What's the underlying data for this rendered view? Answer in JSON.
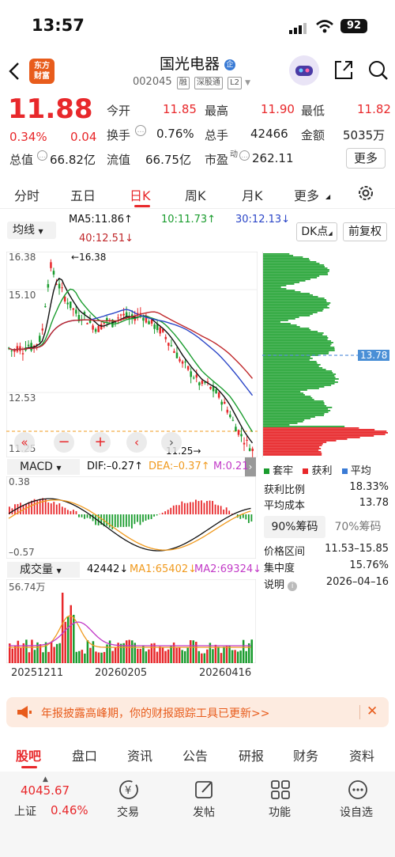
{
  "status": {
    "time": "13:57",
    "battery": "92"
  },
  "header": {
    "logo": "东方财富",
    "name": "国光电器",
    "code": "002045",
    "tags": [
      "融",
      "深股通",
      "L2"
    ],
    "badge": "企"
  },
  "quote": {
    "price": "11.88",
    "chg_pct": "0.34%",
    "chg": "0.04",
    "open_l": "今开",
    "open": "11.85",
    "high_l": "最高",
    "high": "11.90",
    "low_l": "最低",
    "low": "11.82",
    "turn_l": "换手",
    "turn": "0.76%",
    "vol_l": "总手",
    "vol": "42466",
    "amt_l": "金额",
    "amt": "5035万",
    "mcap_l": "总值",
    "mcap": "66.82亿",
    "float_l": "流值",
    "float": "66.75亿",
    "pe_l": "市盈",
    "pe_sup": "动",
    "pe": "262.11",
    "more": "更多"
  },
  "tabs": [
    "分时",
    "五日",
    "日K",
    "周K",
    "月K",
    "更多"
  ],
  "ma": {
    "label": "均线",
    "ma5": "MA5:11.86↑",
    "ma10": "10:11.73↑",
    "ma30": "30:12.13↓",
    "ma40": "40:12.51↓",
    "dk": "DK点",
    "adj": "前复权"
  },
  "kline": {
    "ticks": [
      "16.38",
      "15.10",
      "12.53",
      "11.25"
    ],
    "hi_mark": "16.38",
    "lo_mark": "11.25",
    "dates": [
      "20251211",
      "20260205",
      "20260416"
    ]
  },
  "chips": {
    "price_line": "13.78",
    "legend": [
      "套牢",
      "获利",
      "平均"
    ],
    "rows": [
      [
        "获利比例",
        "18.33%"
      ],
      [
        "平均成本",
        "13.78"
      ]
    ],
    "btn1": "90%筹码",
    "btn2": "70%筹码",
    "rows2": [
      [
        "价格区间",
        "11.53–15.85"
      ],
      [
        "集中度",
        "15.76%"
      ],
      [
        "说明",
        "2026–04–16"
      ]
    ]
  },
  "macd": {
    "label": "MACD",
    "dif": "DIF:–0.27↑",
    "dea": "DEA:–0.37↑",
    "m": "M:0.21",
    "top": "0.38",
    "bot": "–0.57"
  },
  "vol": {
    "label": "成交量",
    "v": "42442↓",
    "ma1": "MA1:65402↓",
    "ma2": "MA2:69324↓",
    "top": "56.74万"
  },
  "banner": {
    "text": "年报披露高峰期，你的财报跟踪工具已更新>>"
  },
  "btabs": [
    "股吧",
    "盘口",
    "资讯",
    "公告",
    "研报",
    "财务",
    "资料"
  ],
  "index": {
    "value": "4045.67",
    "name": "上证",
    "pct": "0.46%"
  },
  "nav": [
    "交易",
    "发帖",
    "功能",
    "设自选"
  ],
  "colors": {
    "red": "#e8282b",
    "green": "#1a9c2e",
    "ma5": "#111111",
    "ma10": "#1a9c2e",
    "ma30": "#2a45c7",
    "ma40": "#c0282b"
  }
}
